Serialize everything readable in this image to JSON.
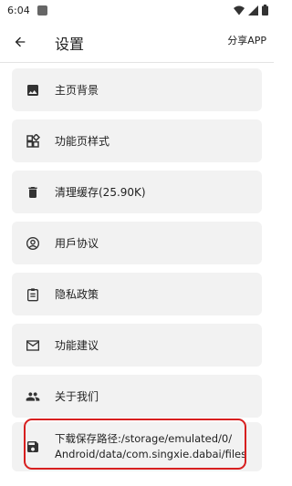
{
  "status_bar": {
    "time": "6:04"
  },
  "app_bar": {
    "title": "设置",
    "share_label": "分享APP"
  },
  "menu": [
    {
      "label": "主页背景",
      "icon": "image-icon"
    },
    {
      "label": "功能页样式",
      "icon": "dashboard-icon"
    },
    {
      "label": "清理缓存(25.90K)",
      "icon": "trash-icon"
    },
    {
      "label": "用戶协议",
      "icon": "account-circle-icon"
    },
    {
      "label": "隐私政策",
      "icon": "assignment-icon"
    },
    {
      "label": "功能建议",
      "icon": "mail-icon"
    },
    {
      "label": "关于我们",
      "icon": "people-icon"
    }
  ],
  "download_path": {
    "line1": "下载保存路径:/storage/emulated/0/",
    "line2": "Android/data/com.singxie.dabai/files",
    "icon": "save-icon"
  },
  "colors": {
    "card_bg": "#f2f2f2",
    "highlight": "#d71f1f",
    "icon": "#333333"
  }
}
